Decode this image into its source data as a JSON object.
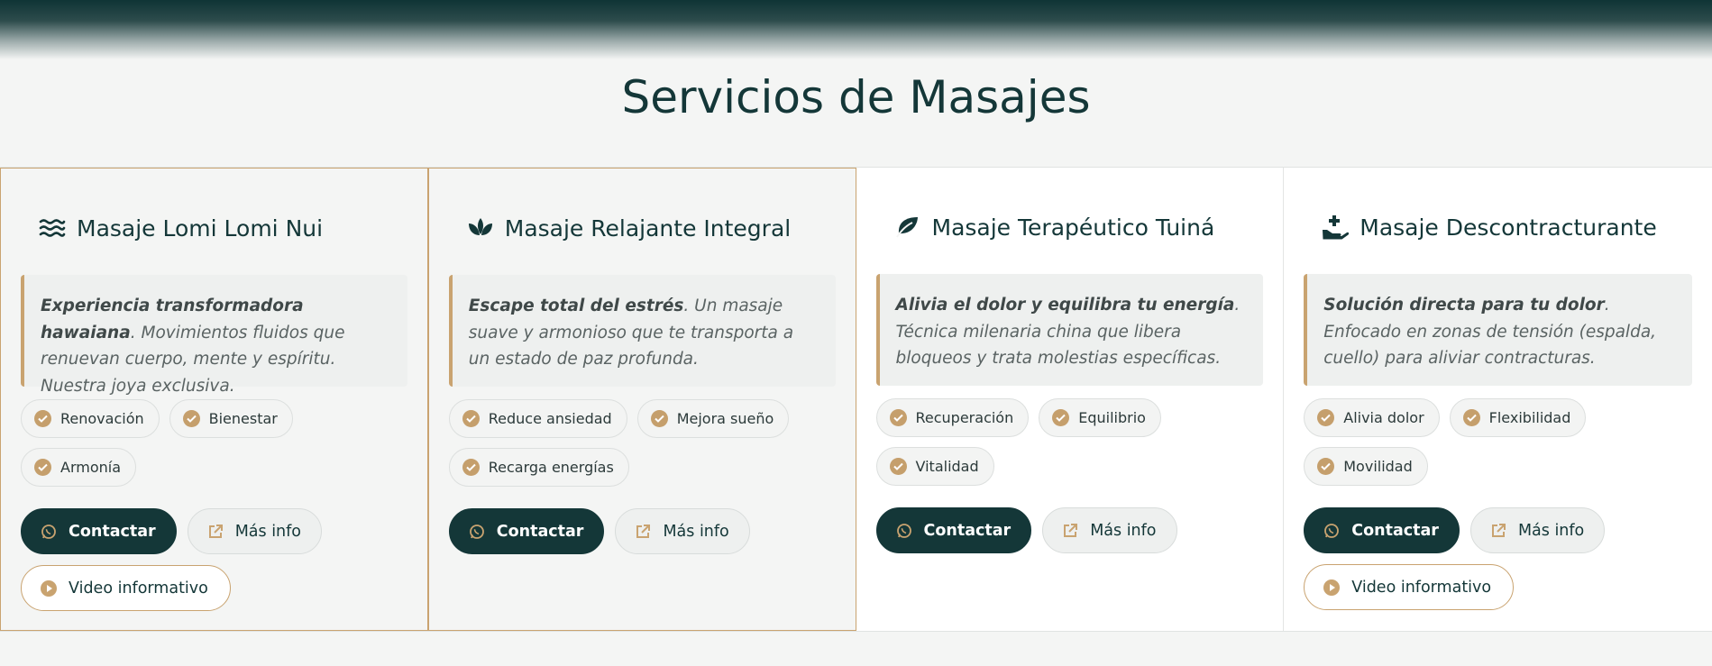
{
  "section": {
    "title": "Servicios de Masajes"
  },
  "colors": {
    "primary": "#143738",
    "accent": "#c9a370",
    "background": "#f4f5f4"
  },
  "cards": [
    {
      "icon": "waves-icon",
      "title": "Masaje Lomi Lomi Nui",
      "lead": "Experiencia transformadora hawaiana",
      "text": ". Movimientos fluidos que renuevan cuerpo, mente y espíritu. Nuestra joya exclusiva.",
      "tags": [
        "Renovación",
        "Bienestar",
        "Armonía"
      ],
      "contact_label": "Contactar",
      "info_label": "Más info",
      "video_label": "Video informativo"
    },
    {
      "icon": "lotus-icon",
      "title": "Masaje Relajante Integral",
      "lead": "Escape total del estrés",
      "text": ". Un masaje suave y armonioso que te transporta a un estado de paz profunda.",
      "tags": [
        "Reduce ansiedad",
        "Mejora sueño",
        "Recarga energías"
      ],
      "contact_label": "Contactar",
      "info_label": "Más info"
    },
    {
      "icon": "leaf-icon",
      "title": "Masaje Terapéutico Tuiná",
      "lead": "Alivia el dolor y equilibra tu energía",
      "text": ". Técnica milenaria china que libera bloqueos y trata molestias específicas.",
      "tags": [
        "Recuperación",
        "Equilibrio",
        "Vitalidad"
      ],
      "contact_label": "Contactar",
      "info_label": "Más info"
    },
    {
      "icon": "hand-medical-icon",
      "title": "Masaje Descontracturante",
      "lead": "Solución directa para tu dolor",
      "text": ". Enfocado en zonas de tensión (espalda, cuello) para aliviar contracturas.",
      "tags": [
        "Alivia dolor",
        "Flexibilidad",
        "Movilidad"
      ],
      "contact_label": "Contactar",
      "info_label": "Más info",
      "video_label": "Video informativo"
    }
  ]
}
